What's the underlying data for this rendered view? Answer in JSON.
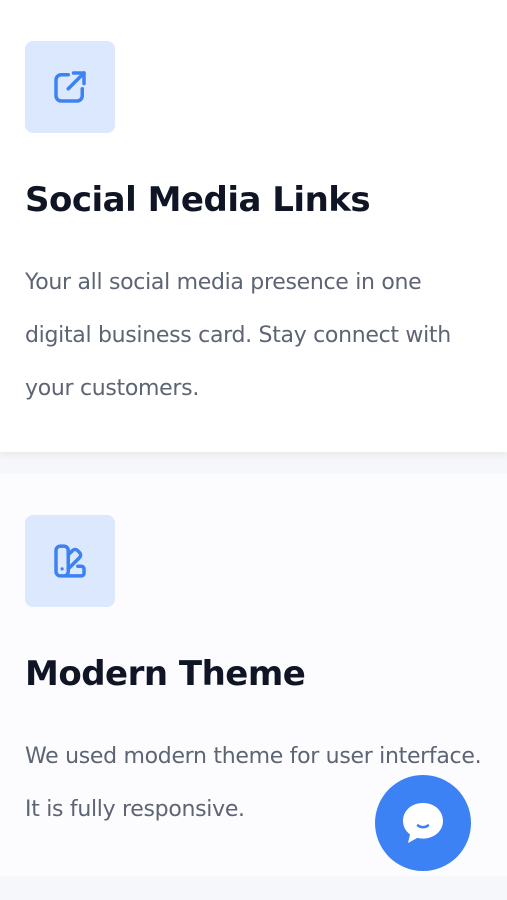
{
  "colors": {
    "accent": "#3d82f4",
    "icon_bg": "#dbe8fd",
    "title": "#0f1524",
    "body_text": "#5d6473"
  },
  "features": [
    {
      "icon": "external-link-icon",
      "title": "Social Media Links",
      "description": "Your all social media presence in one digital business card. Stay connect with your customers."
    },
    {
      "icon": "palette-swatch-icon",
      "title": "Modern Theme",
      "description": "We used modern theme for user interface. It is fully responsive."
    }
  ],
  "chat_widget": {
    "icon": "chat-bubble-icon"
  }
}
